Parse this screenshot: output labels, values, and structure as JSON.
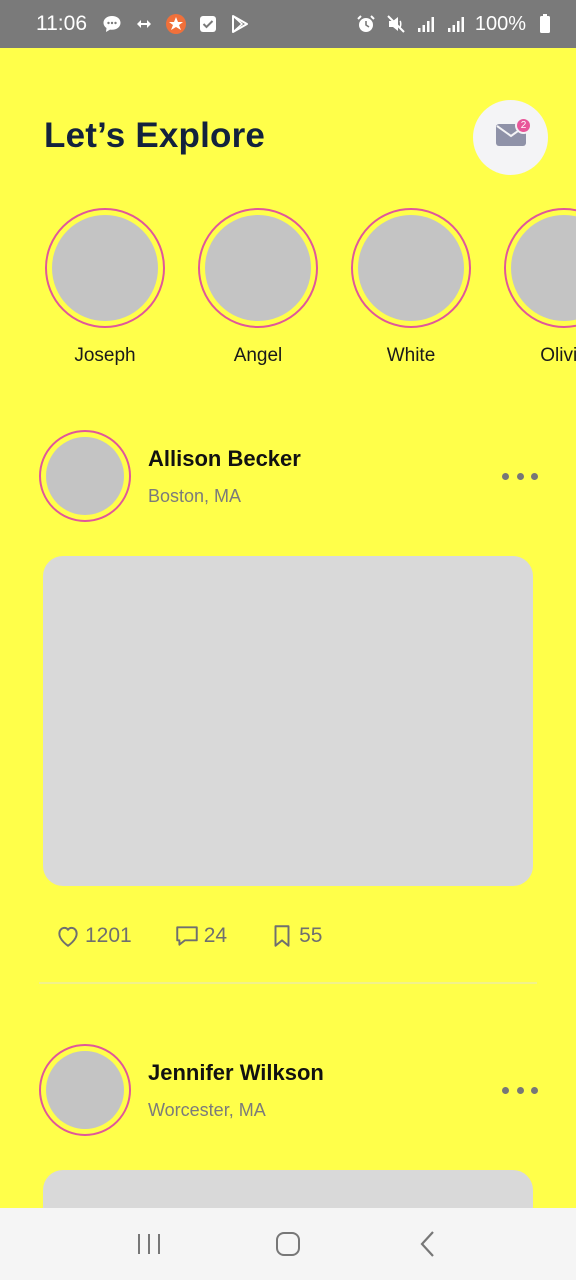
{
  "status_bar": {
    "time": "11:06",
    "battery": "100%",
    "icons": [
      "chat-bubble-icon",
      "sync-arrows-icon",
      "app-badge-icon",
      "checkbox-icon",
      "play-store-icon",
      "alarm-icon",
      "mute-icon",
      "signal-icon",
      "signal-icon",
      "battery-icon"
    ]
  },
  "header": {
    "title": "Let’s Explore",
    "mail_badge_count": "2"
  },
  "stories": [
    {
      "name": "Joseph"
    },
    {
      "name": "Angel"
    },
    {
      "name": "White"
    },
    {
      "name": "Olivia"
    }
  ],
  "posts": [
    {
      "author": "Allison Becker",
      "location": "Boston, MA",
      "likes": "1201",
      "comments": "24",
      "saves": "55"
    },
    {
      "author": "Jennifer Wilkson",
      "location": "Worcester, MA"
    }
  ],
  "colors": {
    "background": "#FFFF4A",
    "title": "#13223D",
    "story_ring": "#E0579A",
    "placeholder": "#C4C4C4",
    "badge": "#E8579A"
  },
  "nav_bar": {
    "icons": [
      "recent-apps-icon",
      "home-icon",
      "back-icon"
    ]
  }
}
